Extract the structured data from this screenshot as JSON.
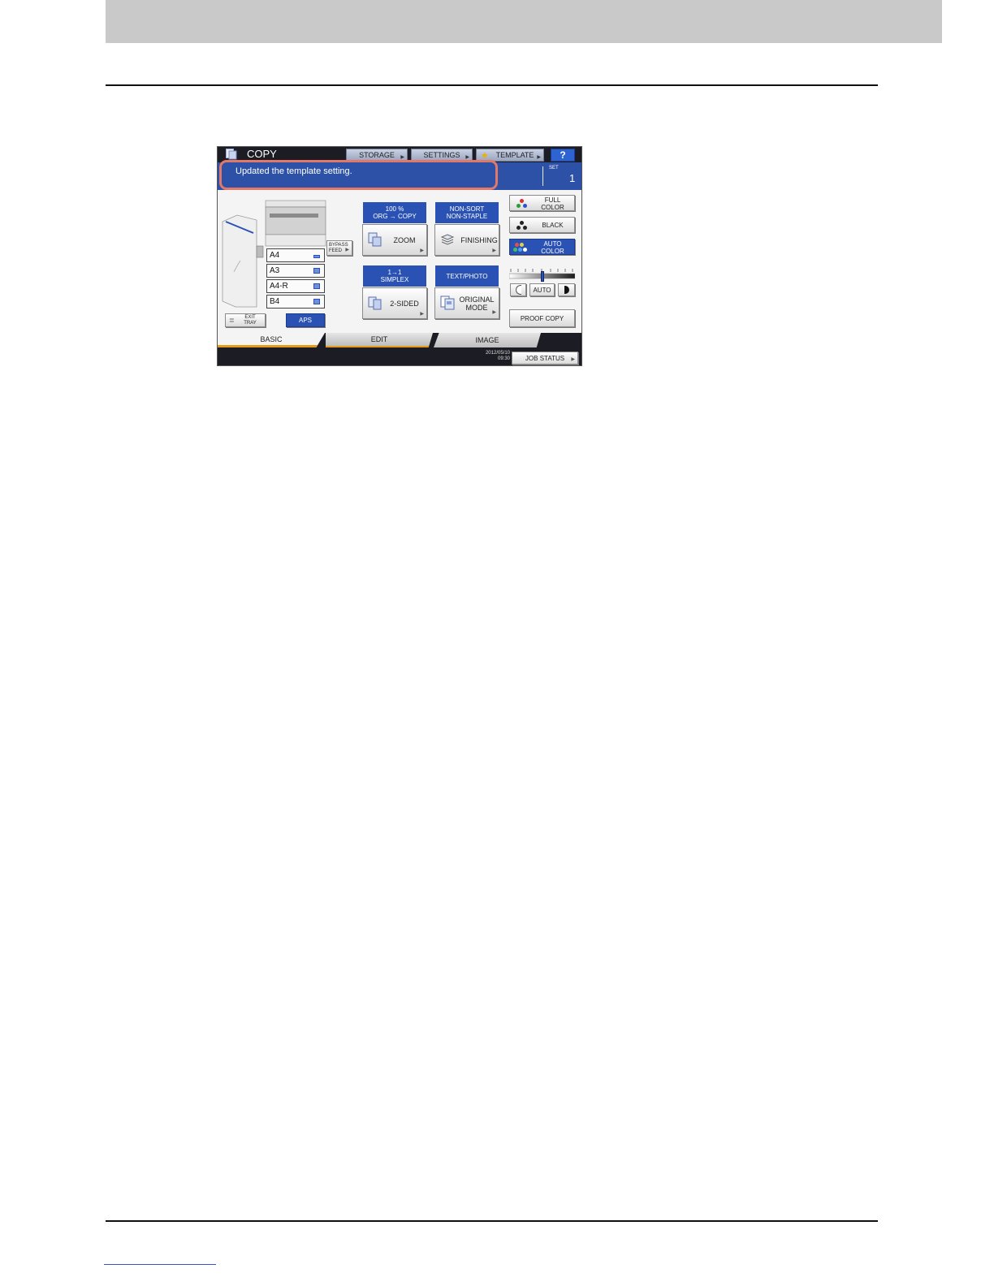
{
  "copy_panel": {
    "header": {
      "title": "COPY",
      "storage": "STORAGE",
      "settings": "SETTINGS",
      "template": "TEMPLATE",
      "help": "?"
    },
    "message": "Updated the template setting.",
    "set": {
      "label": "SET",
      "value": "1"
    },
    "paper": {
      "bypass_line1": "BYPASS",
      "bypass_line2": "FEED",
      "trays": [
        "A4",
        "A3",
        "A4-R",
        "B4"
      ],
      "exit_line1": "EXIT",
      "exit_line2": "TRAY",
      "aps": "APS"
    },
    "zoom": {
      "header_line1": "100 %",
      "header_line2": "ORG  →  COPY",
      "button": "ZOOM"
    },
    "finishing": {
      "header_line1": "NON-SORT",
      "header_line2": "NON-STAPLE",
      "button": "FINISHING"
    },
    "duplex": {
      "header_line1": "1→1",
      "header_line2": "SIMPLEX",
      "button": "2-SIDED"
    },
    "original": {
      "header": "TEXT/PHOTO",
      "button_line1": "ORIGINAL",
      "button_line2": "MODE"
    },
    "color": {
      "full_line1": "FULL",
      "full_line2": "COLOR",
      "black": "BLACK",
      "auto_line1": "AUTO",
      "auto_line2": "COLOR",
      "selected": "AUTO COLOR",
      "accent": "#2a52b4"
    },
    "density": {
      "auto": "AUTO",
      "level_fraction": 0.5
    },
    "proof_copy": "PROOF COPY",
    "tabs": [
      "BASIC",
      "EDIT",
      "IMAGE"
    ],
    "datetime_line1": "2012/05/10",
    "datetime_line2": "09:30",
    "job_status": "JOB STATUS",
    "highlight_color": "#e2786a"
  }
}
